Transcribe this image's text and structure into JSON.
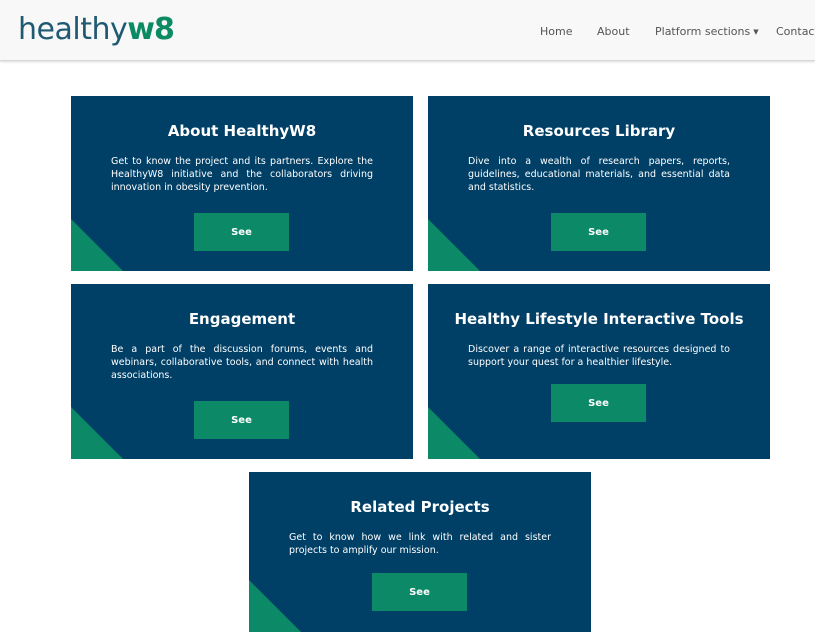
{
  "header": {
    "logo": {
      "part1": "healthy",
      "part2": "w8"
    },
    "nav": [
      {
        "label": "Home"
      },
      {
        "label": "About"
      },
      {
        "label": "Platform sections"
      },
      {
        "label": "Contact"
      }
    ]
  },
  "cards": [
    {
      "title": "About HealthyW8",
      "text": "Get to know the project and its partners. Explore the HealthyW8 initiative and the collaborators driving innovation in obesity prevention.",
      "button": "See"
    },
    {
      "title": "Resources Library",
      "text": "Dive into a wealth of research papers, reports, guidelines, educational materials, and essential data and statistics.",
      "button": "See"
    },
    {
      "title": "Engagement",
      "text": "Be a part of the discussion forums, events and webinars, collaborative tools, and connect with health associations.",
      "button": "See"
    },
    {
      "title": "Healthy Lifestyle Interactive Tools",
      "text": "Discover a range of interactive resources designed to support your quest for a healthier lifestyle.",
      "button": "See"
    },
    {
      "title": "Related Projects",
      "text": "Get to know how we link with related and sister projects to amplify our mission.",
      "button": "See"
    }
  ],
  "colors": {
    "card_bg": "#003f66",
    "accent_green": "#0c8a68",
    "logo_blue": "#1f5a72"
  }
}
